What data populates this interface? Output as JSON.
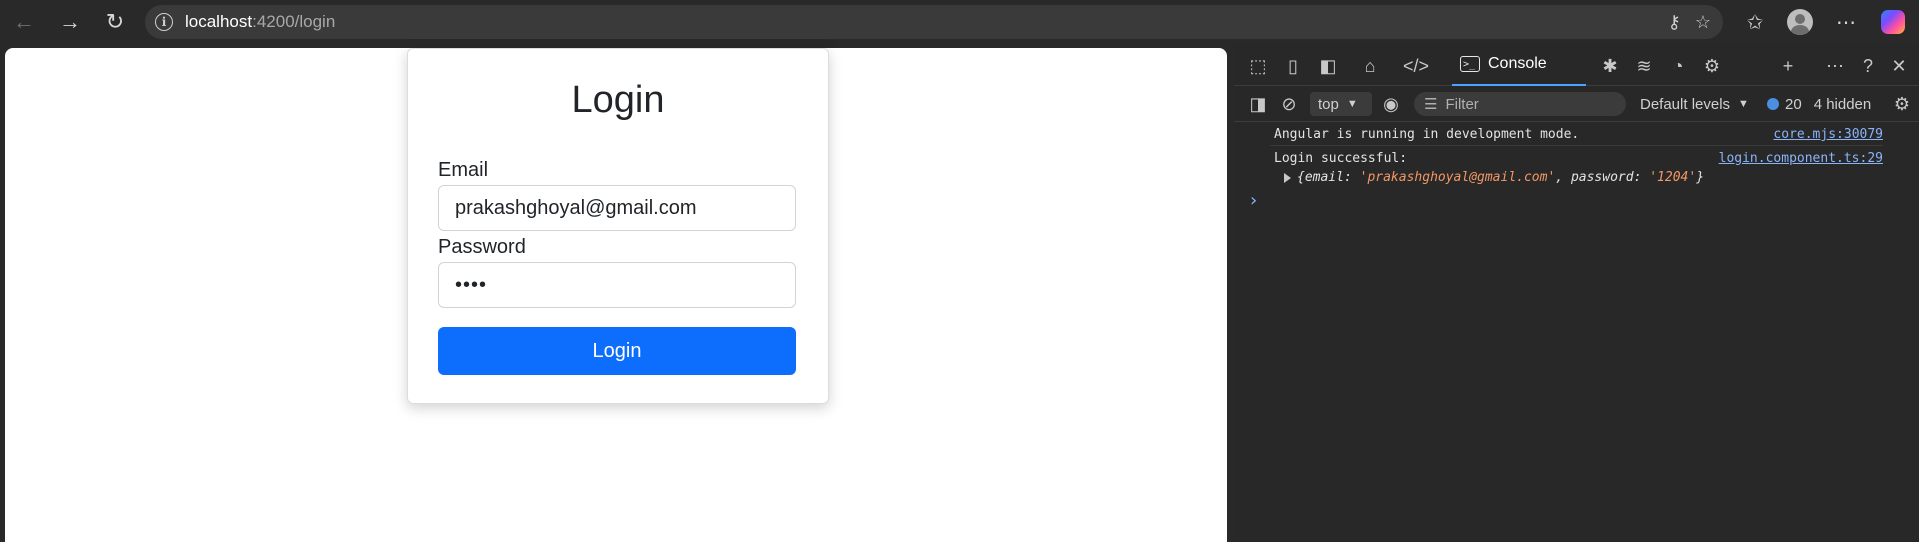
{
  "browser": {
    "url_host": "localhost",
    "url_path": ":4200/login",
    "back_icon": "arrow-left-icon",
    "forward_icon": "arrow-right-icon",
    "refresh_icon": "refresh-icon"
  },
  "login_page": {
    "title": "Login",
    "email_label": "Email",
    "email_value": "prakashghoyal@gmail.com",
    "password_label": "Password",
    "password_value": "••••",
    "submit_label": "Login",
    "button_color": "#0d6efd"
  },
  "devtools": {
    "tab_console": "Console",
    "context": "top",
    "filter_placeholder": "Filter",
    "levels": "Default levels",
    "issues_count": "20",
    "hidden": "4 hidden",
    "logs": [
      {
        "message": "Angular is running in development mode.",
        "source": "core.mjs:30079"
      },
      {
        "message": "Login successful:",
        "source": "login.component.ts:29"
      }
    ],
    "object_preview": {
      "email_key": "email: ",
      "email_value": "'prakashghoyal@gmail.com'",
      "password_key": ", password: ",
      "password_value": "'1204'"
    }
  }
}
